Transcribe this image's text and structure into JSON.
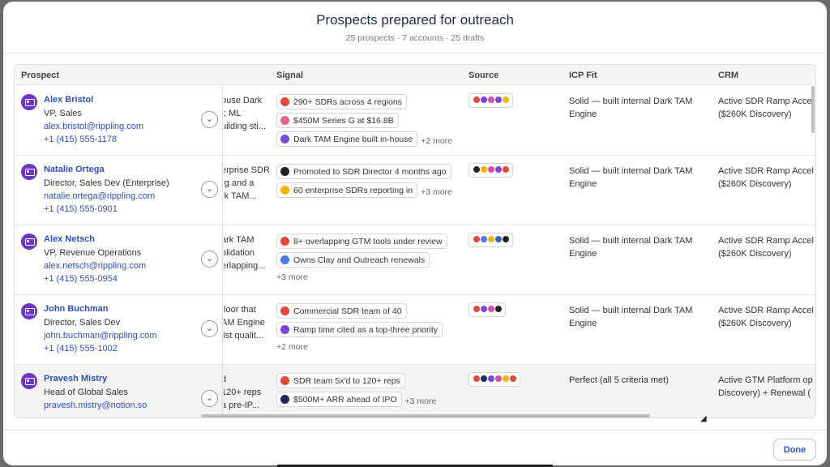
{
  "header": {
    "title": "Prospects prepared for outreach",
    "subtitle": "25 prospects · 7 accounts · 25 drafts"
  },
  "columns": {
    "prospect": "Prospect",
    "signal": "Signal",
    "source": "Source",
    "icp_fit": "ICP Fit",
    "crm": "CRM"
  },
  "rows": [
    {
      "name": "Alex Bristol",
      "title": "VP, Sales",
      "email": "alex.bristol@rippling.com",
      "phone": "+1 (415) 555-1178",
      "clipped": [
        "ouse Dark",
        "t; ML",
        "uilding sti..."
      ],
      "signals": [
        {
          "text": "290+ SDRs across 4 regions",
          "icon": "red-circle-icon"
        },
        {
          "text": "$450M Series G at $16.8B",
          "icon": "pink-circle-icon"
        },
        {
          "text": "Dark TAM Engine built in-house",
          "icon": "purple-circle-icon"
        }
      ],
      "more": "+2 more",
      "source_colors": [
        "#e5483b",
        "#7b3fe4",
        "#d94ba6",
        "#7a47d6",
        "#f2b705"
      ],
      "icp": "Solid — built internal Dark TAM Engine",
      "crm": [
        "Active SDR Ramp Accel",
        "($260K Discovery)"
      ]
    },
    {
      "name": "Natalie Ortega",
      "title": "Director, Sales Dev (Enterprise)",
      "email": "natalie.ortega@rippling.com",
      "phone": "+1 (415) 555-0901",
      "clipped": [
        "erprise SDR",
        "rg and a",
        "rk TAM..."
      ],
      "signals": [
        {
          "text": "Promoted to SDR Director 4 months ago",
          "icon": "black-circle-icon"
        },
        {
          "text": "60 enterprise SDRs reporting in",
          "icon": "yellow-circle-icon"
        }
      ],
      "more": "+3 more",
      "source_colors": [
        "#222222",
        "#f2b705",
        "#d94ba6",
        "#7a47d6",
        "#e5483b"
      ],
      "icp": "Solid — built internal Dark TAM Engine",
      "crm": [
        "Active SDR Ramp Accel",
        "($260K Discovery)"
      ]
    },
    {
      "name": "Alex Netsch",
      "title": "VP, Revenue Operations",
      "email": "alex.netsch@rippling.com",
      "phone": "+1 (415) 555-0954",
      "clipped": [
        "ark TAM",
        "olidation",
        "erlapping..."
      ],
      "signals": [
        {
          "text": "8+ overlapping GTM tools under review",
          "icon": "red-circle-icon"
        },
        {
          "text": "Owns Clay and Outreach renewals",
          "icon": "blue-circle-icon"
        }
      ],
      "more": "+3 more",
      "source_colors": [
        "#e5483b",
        "#4f7be0",
        "#f2b705",
        "#3a5fd0",
        "#222222"
      ],
      "icp": "Solid — built internal Dark TAM Engine",
      "crm": [
        "Active SDR Ramp Accel",
        "($260K Discovery)"
      ]
    },
    {
      "name": "John Buchman",
      "title": "Director, Sales Dev",
      "email": "john.buchman@rippling.com",
      "phone": "+1 (415) 555-1002",
      "clipped": [
        "floor that",
        "AM Engine",
        "list qualit..."
      ],
      "signals": [
        {
          "text": "Commercial SDR team of 40",
          "icon": "red-circle-icon"
        },
        {
          "text": "Ramp time cited as a top-three priority",
          "icon": "purple-circle-icon"
        }
      ],
      "more": "+2 more",
      "source_colors": [
        "#e5483b",
        "#7a47d6",
        "#d94ba6",
        "#222222"
      ],
      "icp": "Solid — built internal Dark TAM Engine",
      "crm": [
        "Active SDR Ramp Accel",
        "($260K Discovery)"
      ]
    },
    {
      "name": "Pravesh Mistry",
      "title": "Head of Global Sales",
      "email": "pravesh.mistry@notion.so",
      "phone": "",
      "clipped": [
        "d",
        "120+ reps",
        "a pre-IP..."
      ],
      "signals": [
        {
          "text": "SDR team 5x'd to 120+ reps",
          "icon": "red-circle-icon"
        },
        {
          "text": "$500M+ ARR ahead of IPO",
          "icon": "navy-circle-icon"
        }
      ],
      "more": "+3 more",
      "source_colors": [
        "#e5483b",
        "#1f2a5c",
        "#7a47d6",
        "#d94ba6",
        "#f2b705",
        "#e5483b"
      ],
      "icp": "Perfect (all 5 criteria met)",
      "crm": [
        "Active GTM Platform op",
        "Discovery) + Renewal ("
      ]
    }
  ],
  "footer": {
    "done_label": "Done"
  }
}
